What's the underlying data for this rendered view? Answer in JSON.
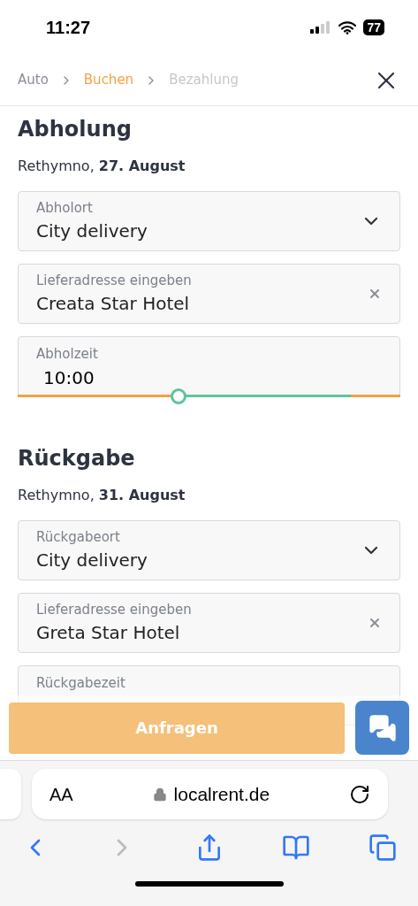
{
  "status_bar": {
    "time": "11:27",
    "battery": "77"
  },
  "breadcrumb": [
    {
      "label": "Auto",
      "selected": false,
      "disabled": false
    },
    {
      "label": "Buchen",
      "selected": true,
      "disabled": false
    },
    {
      "label": "Bezahlung",
      "selected": false,
      "disabled": true
    }
  ],
  "sections": [
    {
      "title": "Abholung",
      "place": "Rethymno, ",
      "date": "27. August",
      "fields": [
        {
          "kind": "select",
          "label": "Abholort",
          "value": "City delivery"
        },
        {
          "kind": "text",
          "label": "Lieferadresse eingeben",
          "value": "Creata Star Hotel"
        },
        {
          "kind": "time",
          "label": "Abholzeit",
          "value": "10:00",
          "level": 0.42
        }
      ]
    },
    {
      "title": "Rückgabe",
      "place": "Rethymno, ",
      "date": "31. August",
      "fields": [
        {
          "kind": "select",
          "label": "Rückgabeort",
          "value": "City delivery"
        },
        {
          "kind": "text",
          "label": "Lieferadresse eingeben",
          "value": "Greta Star Hotel"
        },
        {
          "kind": "time",
          "label": "Rückgabezeit"
        }
      ]
    }
  ],
  "submit": {
    "label": "Anfragen",
    "disabled": true
  },
  "browser": {
    "text_size": "AA",
    "url": "localrent.de"
  }
}
